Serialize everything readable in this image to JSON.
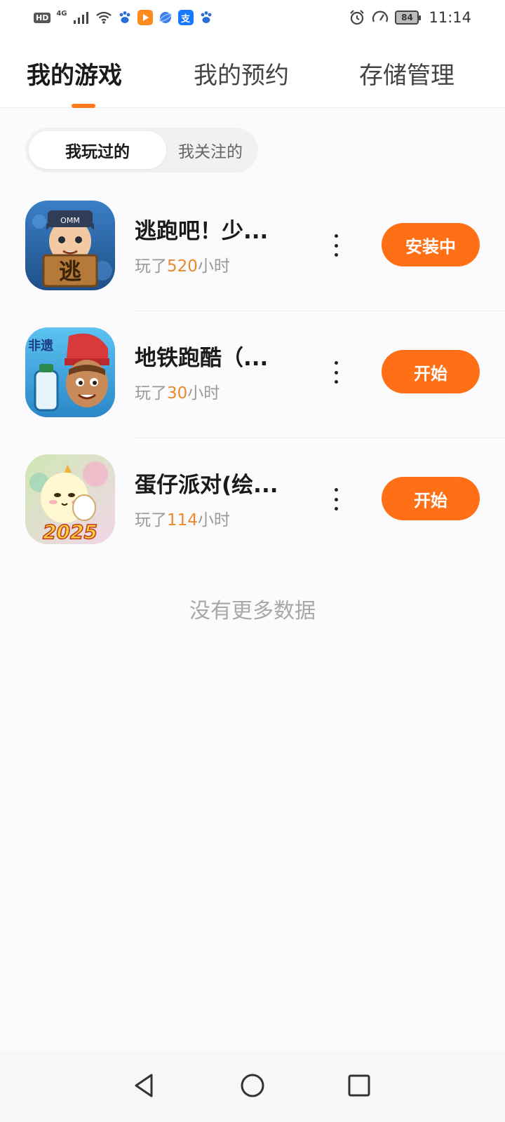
{
  "status_bar": {
    "hd": "HD",
    "network": "4G",
    "time": "11:14",
    "battery": "84",
    "icons": [
      "signal-icon",
      "wifi-icon",
      "baidu-paw-icon",
      "video-app-icon",
      "browser-icon",
      "alipay-icon",
      "baidu-paw-icon",
      "alarm-icon",
      "speed-icon",
      "battery-icon"
    ],
    "alipay_glyph": "支"
  },
  "top_tabs": [
    {
      "label": "我的游戏",
      "active": true
    },
    {
      "label": "我的预约",
      "active": false
    },
    {
      "label": "存储管理",
      "active": false
    }
  ],
  "sub_tabs": [
    {
      "label": "我玩过的",
      "active": true
    },
    {
      "label": "我关注的",
      "active": false
    }
  ],
  "games": [
    {
      "title": "逃跑吧！少...",
      "played_prefix": "玩了",
      "hours": "520",
      "played_suffix": "小时",
      "action": "安装中",
      "icon_badge": "逃",
      "icon_cap": "OMM"
    },
    {
      "title": "地铁跑酷（...",
      "played_prefix": "玩了",
      "hours": "30",
      "played_suffix": "小时",
      "action": "开始",
      "icon_badge": "非遗"
    },
    {
      "title": "蛋仔派对(绘...",
      "played_prefix": "玩了",
      "hours": "114",
      "played_suffix": "小时",
      "action": "开始",
      "icon_badge": "2025"
    }
  ],
  "empty_text": "没有更多数据",
  "colors": {
    "accent": "#ff7016",
    "hours": "#e98a2b"
  }
}
